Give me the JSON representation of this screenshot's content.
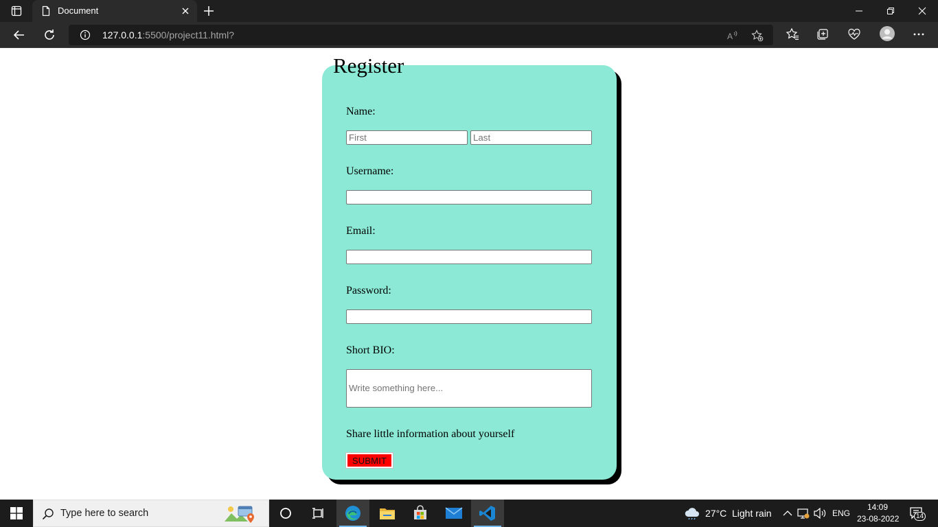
{
  "browser": {
    "tab_title": "Document",
    "address_host": "127.0.0.1",
    "address_path": ":5500/project11.html?"
  },
  "form": {
    "title": "Register",
    "name_label": "Name:",
    "first_placeholder": "First",
    "last_placeholder": "Last",
    "username_label": "Username:",
    "email_label": "Email:",
    "password_label": "Password:",
    "bio_label": "Short BIO:",
    "bio_placeholder": "Write something here...",
    "hint": "Share little information about yourself",
    "submit_label": "SUBMIT",
    "card_color": "#8be9d6",
    "submit_color": "#ff0000"
  },
  "taskbar": {
    "search_placeholder": "Type here to search",
    "weather_temp": "27°C",
    "weather_desc": "Light rain",
    "language": "ENG",
    "time": "14:09",
    "date": "23-08-2022",
    "notification_count": "14"
  }
}
